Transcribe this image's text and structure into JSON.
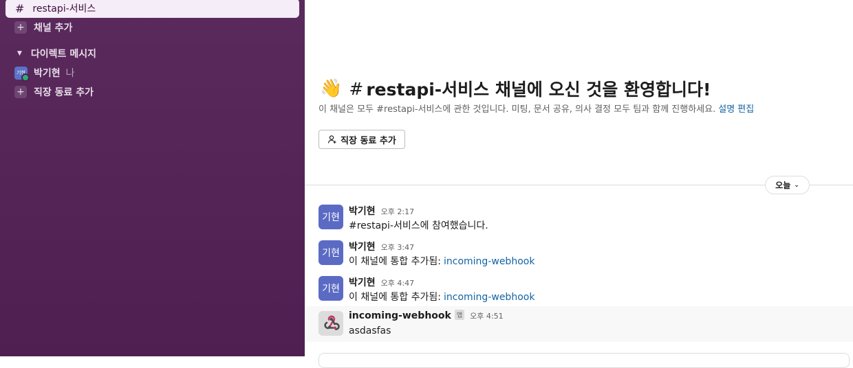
{
  "sidebar": {
    "active_channel": "restapi-서비스",
    "add_channel_label": "채널 추가",
    "dm_section_label": "다이렉트 메시지",
    "dm_user_name": "박기현",
    "dm_user_suffix": "나",
    "dm_avatar_text": "기현",
    "add_coworker_label": "직장 동료 추가"
  },
  "channel_intro": {
    "wave_emoji": "👋",
    "hash": "#",
    "title": "restapi-서비스 채널에 오신 것을 환영합니다!",
    "description": "이 채널은 모두 #restapi-서비스에 관한 것입니다. 미팅, 문서 공유, 의사 결정 모두 팀과 함께 진행하세요.",
    "edit_description_link": "설명 편집",
    "add_coworker_button": "직장 동료 추가"
  },
  "date_divider": {
    "label": "오늘"
  },
  "messages": [
    {
      "avatar": "기현",
      "sender": "박기현",
      "time": "오후 2:17",
      "text": "#restapi-서비스에 참여했습니다.",
      "link": ""
    },
    {
      "avatar": "기현",
      "sender": "박기현",
      "time": "오후 3:47",
      "text": "이 채널에 통합 추가됨:",
      "link": "incoming-webhook"
    },
    {
      "avatar": "기현",
      "sender": "박기현",
      "time": "오후 4:47",
      "text": "이 채널에 통합 추가됨:",
      "link": "incoming-webhook"
    },
    {
      "avatar_icon": "webhook-icon",
      "sender": "incoming-webhook",
      "badge": "앱",
      "time": "오후 4:51",
      "text": "asdasfas"
    }
  ],
  "colors": {
    "sidebar_bg": "#4f1f52",
    "link": "#1264a3",
    "avatar_bg": "#5b6bc4",
    "presence_online": "#2bac76"
  }
}
